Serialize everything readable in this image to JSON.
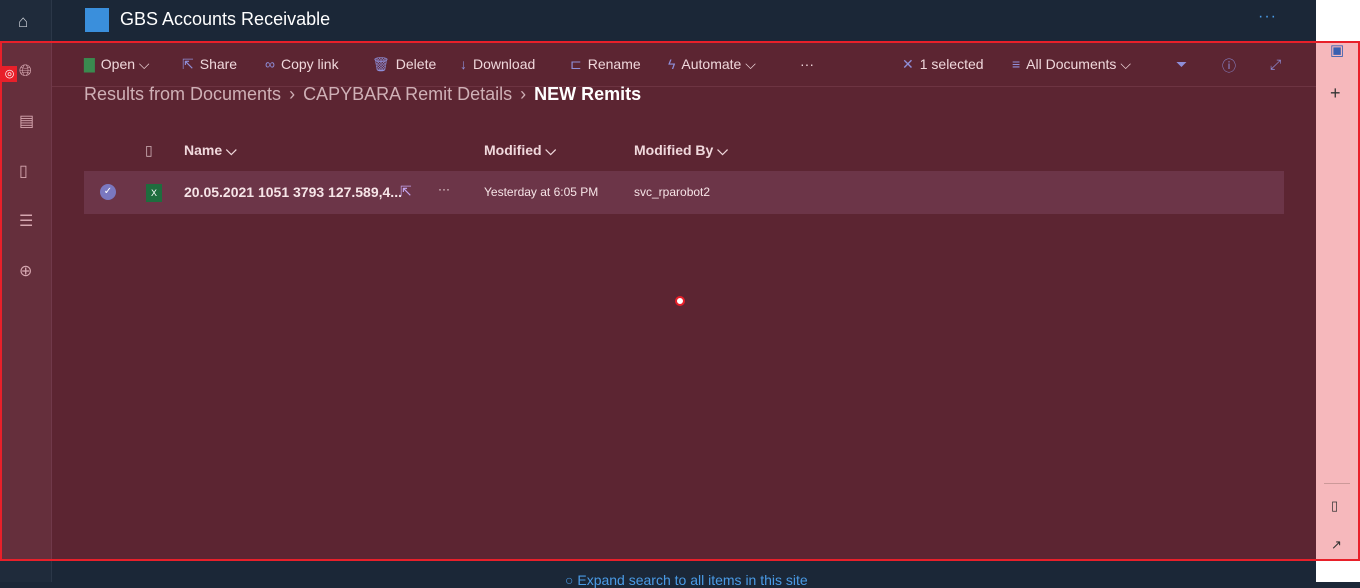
{
  "site": {
    "title": "GBS Accounts Receivable",
    "more": "···"
  },
  "toolbar": {
    "open": "Open",
    "share": "Share",
    "copy_link": "Copy link",
    "delete": "Delete",
    "download": "Download",
    "rename": "Rename",
    "automate": "Automate",
    "more": "···",
    "selected": "1 selected",
    "view": "All Documents"
  },
  "breadcrumb": [
    "Results from Documents",
    "CAPYBARA Remit Details",
    "NEW Remits"
  ],
  "columns": {
    "name": "Name",
    "modified": "Modified",
    "modified_by": "Modified By"
  },
  "rows": [
    {
      "name": "20.05.2021 1051 3793 127.589,4...",
      "modified": "Yesterday at 6:05 PM",
      "modified_by": "svc_rparobot2"
    }
  ],
  "footer": {
    "expand": "Expand search to all items in this site"
  }
}
